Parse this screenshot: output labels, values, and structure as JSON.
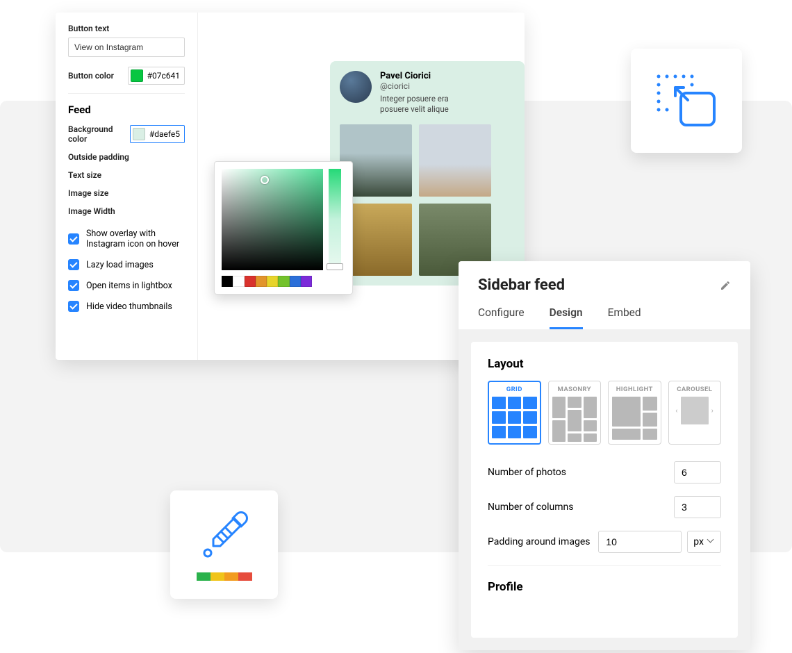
{
  "settings": {
    "button_text_label": "Button text",
    "button_text_value": "View on Instagram",
    "button_color_label": "Button color",
    "button_color_value": "#07c641",
    "feed_heading": "Feed",
    "bg_color_label": "Background color",
    "bg_color_value": "#daefe5",
    "outside_padding_label": "Outside padding",
    "text_size_label": "Text size",
    "image_size_label": "Image size",
    "image_width_label": "Image Width",
    "checkboxes": [
      "Show overlay with Instagram icon on hover",
      "Lazy load images",
      "Open items in lightbox",
      "Hide video thumbnails"
    ]
  },
  "picker": {
    "presets": [
      "#000000",
      "#ffffff",
      "#d9322d",
      "#e2942b",
      "#e7d42b",
      "#73c22b",
      "#2b6fd9",
      "#7b2bd9"
    ]
  },
  "preview": {
    "name": "Pavel Ciorici",
    "handle": "@ciorici",
    "bio1": "Integer posuere era",
    "bio2": "posuere velit alique"
  },
  "editor": {
    "title": "Sidebar feed",
    "tabs": {
      "configure": "Configure",
      "design": "Design",
      "embed": "Embed"
    },
    "layout_heading": "Layout",
    "layouts": [
      "GRID",
      "MASONRY",
      "HIGHLIGHT",
      "CAROUSEL"
    ],
    "num_photos_label": "Number of photos",
    "num_photos_value": "6",
    "num_columns_label": "Number of columns",
    "num_columns_value": "3",
    "padding_label": "Padding around images",
    "padding_value": "10",
    "padding_unit": "px",
    "profile_heading": "Profile"
  }
}
